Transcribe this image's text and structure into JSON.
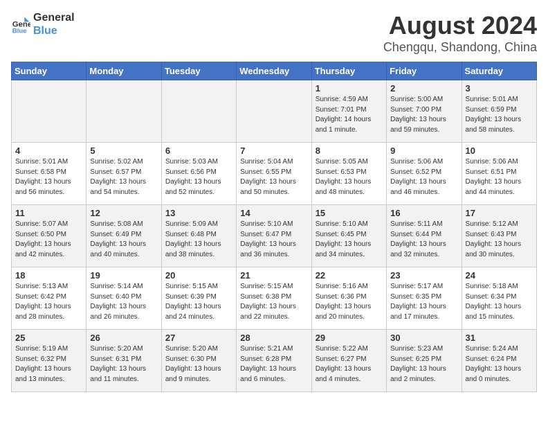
{
  "logo": {
    "line1": "General",
    "line2": "Blue"
  },
  "title": "August 2024",
  "subtitle": "Chengqu, Shandong, China",
  "days_of_week": [
    "Sunday",
    "Monday",
    "Tuesday",
    "Wednesday",
    "Thursday",
    "Friday",
    "Saturday"
  ],
  "weeks": [
    [
      {
        "day": "",
        "info": ""
      },
      {
        "day": "",
        "info": ""
      },
      {
        "day": "",
        "info": ""
      },
      {
        "day": "",
        "info": ""
      },
      {
        "day": "1",
        "info": "Sunrise: 4:59 AM\nSunset: 7:01 PM\nDaylight: 14 hours\nand 1 minute."
      },
      {
        "day": "2",
        "info": "Sunrise: 5:00 AM\nSunset: 7:00 PM\nDaylight: 13 hours\nand 59 minutes."
      },
      {
        "day": "3",
        "info": "Sunrise: 5:01 AM\nSunset: 6:59 PM\nDaylight: 13 hours\nand 58 minutes."
      }
    ],
    [
      {
        "day": "4",
        "info": "Sunrise: 5:01 AM\nSunset: 6:58 PM\nDaylight: 13 hours\nand 56 minutes."
      },
      {
        "day": "5",
        "info": "Sunrise: 5:02 AM\nSunset: 6:57 PM\nDaylight: 13 hours\nand 54 minutes."
      },
      {
        "day": "6",
        "info": "Sunrise: 5:03 AM\nSunset: 6:56 PM\nDaylight: 13 hours\nand 52 minutes."
      },
      {
        "day": "7",
        "info": "Sunrise: 5:04 AM\nSunset: 6:55 PM\nDaylight: 13 hours\nand 50 minutes."
      },
      {
        "day": "8",
        "info": "Sunrise: 5:05 AM\nSunset: 6:53 PM\nDaylight: 13 hours\nand 48 minutes."
      },
      {
        "day": "9",
        "info": "Sunrise: 5:06 AM\nSunset: 6:52 PM\nDaylight: 13 hours\nand 46 minutes."
      },
      {
        "day": "10",
        "info": "Sunrise: 5:06 AM\nSunset: 6:51 PM\nDaylight: 13 hours\nand 44 minutes."
      }
    ],
    [
      {
        "day": "11",
        "info": "Sunrise: 5:07 AM\nSunset: 6:50 PM\nDaylight: 13 hours\nand 42 minutes."
      },
      {
        "day": "12",
        "info": "Sunrise: 5:08 AM\nSunset: 6:49 PM\nDaylight: 13 hours\nand 40 minutes."
      },
      {
        "day": "13",
        "info": "Sunrise: 5:09 AM\nSunset: 6:48 PM\nDaylight: 13 hours\nand 38 minutes."
      },
      {
        "day": "14",
        "info": "Sunrise: 5:10 AM\nSunset: 6:47 PM\nDaylight: 13 hours\nand 36 minutes."
      },
      {
        "day": "15",
        "info": "Sunrise: 5:10 AM\nSunset: 6:45 PM\nDaylight: 13 hours\nand 34 minutes."
      },
      {
        "day": "16",
        "info": "Sunrise: 5:11 AM\nSunset: 6:44 PM\nDaylight: 13 hours\nand 32 minutes."
      },
      {
        "day": "17",
        "info": "Sunrise: 5:12 AM\nSunset: 6:43 PM\nDaylight: 13 hours\nand 30 minutes."
      }
    ],
    [
      {
        "day": "18",
        "info": "Sunrise: 5:13 AM\nSunset: 6:42 PM\nDaylight: 13 hours\nand 28 minutes."
      },
      {
        "day": "19",
        "info": "Sunrise: 5:14 AM\nSunset: 6:40 PM\nDaylight: 13 hours\nand 26 minutes."
      },
      {
        "day": "20",
        "info": "Sunrise: 5:15 AM\nSunset: 6:39 PM\nDaylight: 13 hours\nand 24 minutes."
      },
      {
        "day": "21",
        "info": "Sunrise: 5:15 AM\nSunset: 6:38 PM\nDaylight: 13 hours\nand 22 minutes."
      },
      {
        "day": "22",
        "info": "Sunrise: 5:16 AM\nSunset: 6:36 PM\nDaylight: 13 hours\nand 20 minutes."
      },
      {
        "day": "23",
        "info": "Sunrise: 5:17 AM\nSunset: 6:35 PM\nDaylight: 13 hours\nand 17 minutes."
      },
      {
        "day": "24",
        "info": "Sunrise: 5:18 AM\nSunset: 6:34 PM\nDaylight: 13 hours\nand 15 minutes."
      }
    ],
    [
      {
        "day": "25",
        "info": "Sunrise: 5:19 AM\nSunset: 6:32 PM\nDaylight: 13 hours\nand 13 minutes."
      },
      {
        "day": "26",
        "info": "Sunrise: 5:20 AM\nSunset: 6:31 PM\nDaylight: 13 hours\nand 11 minutes."
      },
      {
        "day": "27",
        "info": "Sunrise: 5:20 AM\nSunset: 6:30 PM\nDaylight: 13 hours\nand 9 minutes."
      },
      {
        "day": "28",
        "info": "Sunrise: 5:21 AM\nSunset: 6:28 PM\nDaylight: 13 hours\nand 6 minutes."
      },
      {
        "day": "29",
        "info": "Sunrise: 5:22 AM\nSunset: 6:27 PM\nDaylight: 13 hours\nand 4 minutes."
      },
      {
        "day": "30",
        "info": "Sunrise: 5:23 AM\nSunset: 6:25 PM\nDaylight: 13 hours\nand 2 minutes."
      },
      {
        "day": "31",
        "info": "Sunrise: 5:24 AM\nSunset: 6:24 PM\nDaylight: 13 hours\nand 0 minutes."
      }
    ]
  ]
}
